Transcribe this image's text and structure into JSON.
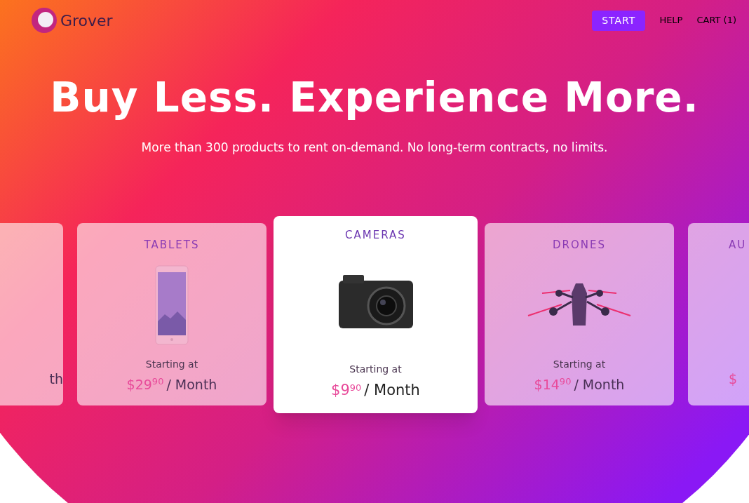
{
  "header": {
    "logo": "Grover",
    "nav": [
      {
        "label": "START",
        "kind": "button"
      },
      {
        "label": "HELP",
        "kind": "link"
      },
      {
        "label": "CART (1)",
        "kind": "link"
      }
    ]
  },
  "hero": {
    "title": "Buy Less. Experience More.",
    "subtitle": "More than 300 products to rent on-demand. No long-term contracts, no limits."
  },
  "cards": [
    {
      "kind": "clipped-left",
      "unit": "th",
      "selected": false
    },
    {
      "kind": "full",
      "title": "TABLETS",
      "starting": "Starting at",
      "price": "$29$^{90}$",
      "unit": "/ Month",
      "selected": false
    },
    {
      "kind": "full",
      "title": "CAMERAS",
      "starting": "Starting at",
      "price": "$9$^{90}$",
      "unit": "/ Month",
      "selected": true
    },
    {
      "kind": "full",
      "title": "DRONES",
      "starting": "Starting at",
      "price": "$14$^{90}$",
      "unit": "/ Month",
      "selected": false
    },
    {
      "kind": "clipped-right",
      "title": "AU",
      "price": "$",
      "selected": false
    }
  ]
}
